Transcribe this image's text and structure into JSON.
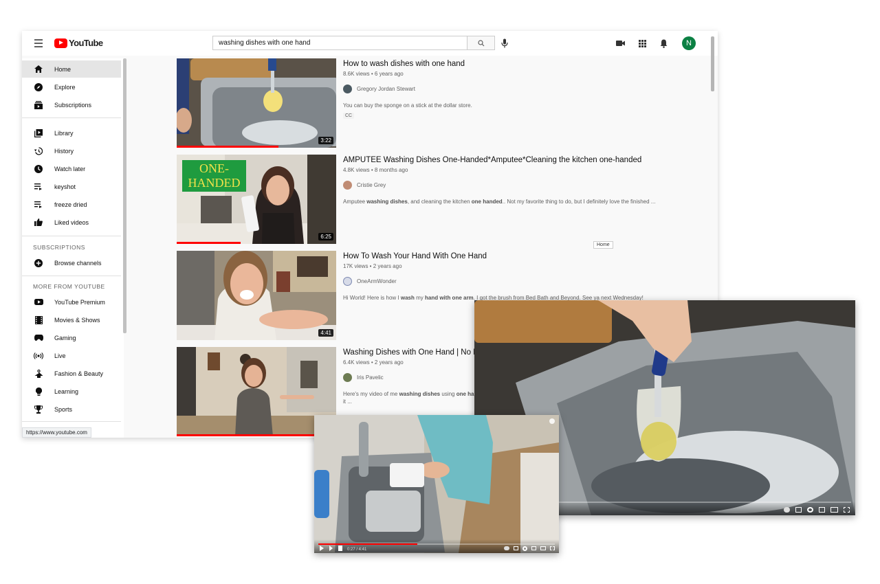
{
  "masthead": {
    "logo_text": "YouTube",
    "search_value": "washing dishes with one hand",
    "avatar_letter": "N"
  },
  "sidebar": {
    "primary": [
      {
        "label": "Home",
        "icon": "home-icon"
      },
      {
        "label": "Explore",
        "icon": "compass-icon"
      },
      {
        "label": "Subscriptions",
        "icon": "subscriptions-icon"
      }
    ],
    "library": [
      {
        "label": "Library",
        "icon": "library-icon"
      },
      {
        "label": "History",
        "icon": "history-icon"
      },
      {
        "label": "Watch later",
        "icon": "clock-icon"
      },
      {
        "label": "keyshot",
        "icon": "playlist-icon"
      },
      {
        "label": "freeze dried",
        "icon": "playlist-icon"
      },
      {
        "label": "Liked videos",
        "icon": "thumbs-up-icon"
      }
    ],
    "subscriptions_heading": "SUBSCRIPTIONS",
    "browse_channels": "Browse channels",
    "more_heading": "MORE FROM YOUTUBE",
    "more": [
      {
        "label": "YouTube Premium",
        "icon": "youtube-icon"
      },
      {
        "label": "Movies & Shows",
        "icon": "film-icon"
      },
      {
        "label": "Gaming",
        "icon": "gamepad-icon"
      },
      {
        "label": "Live",
        "icon": "live-icon"
      },
      {
        "label": "Fashion & Beauty",
        "icon": "hanger-icon"
      },
      {
        "label": "Learning",
        "icon": "lightbulb-icon"
      },
      {
        "label": "Sports",
        "icon": "trophy-icon"
      }
    ]
  },
  "status_url": "https://www.youtube.com",
  "tooltip": "Home",
  "results": [
    {
      "title": "How to wash dishes with one hand",
      "meta": "8.6K views • 6 years ago",
      "channel": "Gregory Jordan Stewart",
      "description": "You can buy the sponge on a stick at the dollar store.",
      "badge": "CC",
      "duration": "3:22",
      "watched": 0.64
    },
    {
      "title": "AMPUTEE Washing Dishes One-Handed*Amputee*Cleaning the kitchen one-handed",
      "meta": "4.8K views • 8 months ago",
      "channel": "Cristie Grey",
      "description_parts": [
        "Amputee ",
        "washing dishes",
        ", and cleaning the kitchen ",
        "one handed",
        ".. Not my favorite thing to do, but I definitely love the finished ..."
      ],
      "thumb_text": "ONE-\nHANDED",
      "duration": "6:25",
      "watched": 0.4
    },
    {
      "title": "How To Wash Your Hand With One Hand",
      "meta": "17K views • 2 years ago",
      "channel": "OneArmWonder",
      "description_parts": [
        "Hi World! Here is how I ",
        "wash",
        " my ",
        "hand with one arm",
        ". I got the brush from Bed Bath and Beyond. See ya next Wednesday!"
      ],
      "duration": "4:41",
      "watched": 0
    },
    {
      "title": "Washing Dishes with One Hand | No L",
      "meta": "6.4K views • 2 years ago",
      "channel": "Iris Pavelic",
      "description_parts": [
        "Here's my video of me ",
        "washing dishes",
        " using ",
        "one han"
      ],
      "description_line2": "it ...",
      "duration": "",
      "watched": 0.95
    }
  ],
  "players": {
    "small_time": "0:27 / 4:41",
    "big_progress": 0.16,
    "small_progress": 0.42
  }
}
